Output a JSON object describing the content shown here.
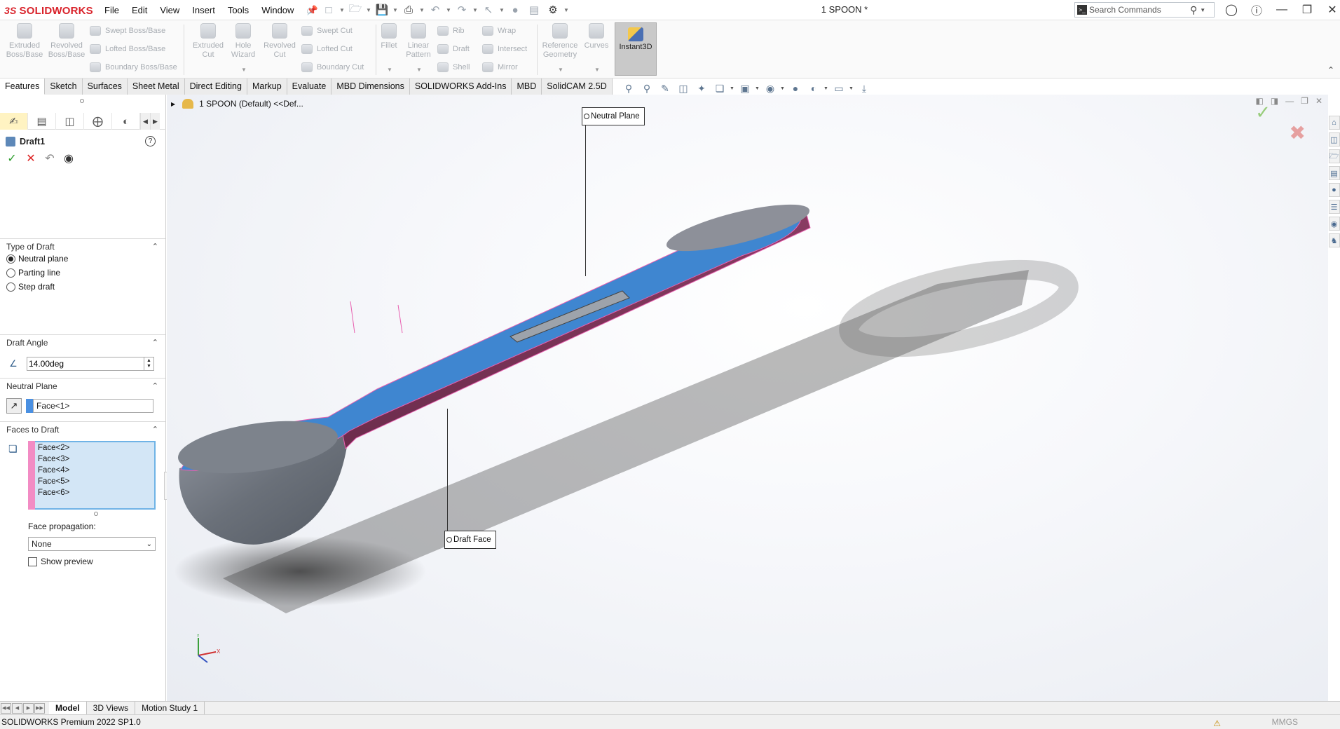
{
  "app": {
    "brand_prefix": "3S",
    "brand": "SOLIDWORKS",
    "document_title": "1 SPOON *"
  },
  "menu": [
    "File",
    "Edit",
    "View",
    "Insert",
    "Tools",
    "Window"
  ],
  "search": {
    "placeholder": "Search Commands"
  },
  "ribbon": {
    "extruded_boss": "Extruded Boss/Base",
    "revolved_boss": "Revolved Boss/Base",
    "swept_boss": "Swept Boss/Base",
    "lofted_boss": "Lofted Boss/Base",
    "boundary_boss": "Boundary Boss/Base",
    "extruded_cut": "Extruded Cut",
    "hole_wizard": "Hole Wizard",
    "revolved_cut": "Revolved Cut",
    "swept_cut": "Swept Cut",
    "lofted_cut": "Lofted Cut",
    "boundary_cut": "Boundary Cut",
    "fillet": "Fillet",
    "linear_pattern": "Linear Pattern",
    "rib": "Rib",
    "draft": "Draft",
    "shell": "Shell",
    "wrap": "Wrap",
    "intersect": "Intersect",
    "mirror": "Mirror",
    "reference_geometry": "Reference Geometry",
    "curves": "Curves",
    "instant3d": "Instant3D"
  },
  "tabs": [
    "Features",
    "Sketch",
    "Surfaces",
    "Sheet Metal",
    "Direct Editing",
    "Markup",
    "Evaluate",
    "MBD Dimensions",
    "SOLIDWORKS Add-Ins",
    "MBD",
    "SolidCAM 2.5D"
  ],
  "property_manager": {
    "title": "Draft1",
    "help": "?",
    "type_section": "Type of Draft",
    "types": [
      {
        "label": "Neutral plane",
        "selected": true
      },
      {
        "label": "Parting line",
        "selected": false
      },
      {
        "label": "Step draft",
        "selected": false
      }
    ],
    "angle_section": "Draft Angle",
    "angle_value": "14.00deg",
    "neutral_section": "Neutral Plane",
    "neutral_value": "Face<1>",
    "neutral_color": "#4a90e2",
    "faces_section": "Faces to Draft",
    "faces": [
      "Face<2>",
      "Face<3>",
      "Face<4>",
      "Face<5>",
      "Face<6>"
    ],
    "faces_color": "#f28cc4",
    "face_propagation_label": "Face propagation:",
    "face_propagation_value": "None",
    "show_preview_label": "Show preview",
    "show_preview_checked": false
  },
  "viewport": {
    "tree_label": "1 SPOON (Default) <<Def...",
    "callout_neutral": "Neutral Plane",
    "callout_draft": "Draft Face",
    "triad_x": "X",
    "triad_y": "Y"
  },
  "bottom_tabs": [
    "Model",
    "3D Views",
    "Motion Study 1"
  ],
  "status": {
    "product": "SOLIDWORKS Premium 2022 SP1.0",
    "units": "MMGS"
  }
}
